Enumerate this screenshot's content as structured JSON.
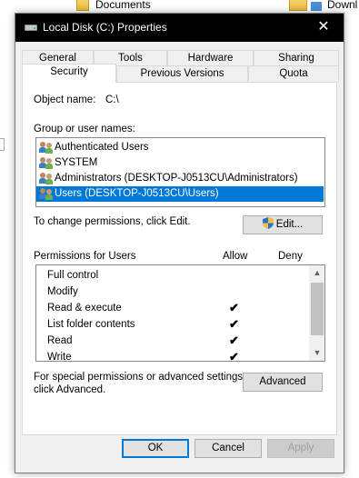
{
  "background": {
    "documents_label": "Documents",
    "downloads_label": "Downl"
  },
  "dialog": {
    "title": "Local Disk (C:) Properties",
    "close_glyph": "✕"
  },
  "tabs": {
    "row1": [
      "General",
      "Tools",
      "Hardware",
      "Sharing"
    ],
    "row2": [
      "Security",
      "Previous Versions",
      "Quota"
    ],
    "active": "Security"
  },
  "security": {
    "object_name_label": "Object name:",
    "object_name_value": "C:\\",
    "group_label": "Group or user names:",
    "groups": [
      "Authenticated Users",
      "SYSTEM",
      "Administrators (DESKTOP-J0513CU\\Administrators)",
      "Users (DESKTOP-J0513CU\\Users)"
    ],
    "selected_group_index": 3,
    "change_hint": "To change permissions, click Edit.",
    "edit_button": "Edit...",
    "permissions_label": "Permissions for Users",
    "allow_header": "Allow",
    "deny_header": "Deny",
    "permissions": [
      {
        "name": "Full control",
        "allow": false,
        "deny": false
      },
      {
        "name": "Modify",
        "allow": false,
        "deny": false
      },
      {
        "name": "Read & execute",
        "allow": true,
        "deny": false
      },
      {
        "name": "List folder contents",
        "allow": true,
        "deny": false
      },
      {
        "name": "Read",
        "allow": true,
        "deny": false
      },
      {
        "name": "Write",
        "allow": true,
        "deny": false
      }
    ],
    "check_glyph": "✔",
    "special_hint_line1": "For special permissions or advanced settings,",
    "special_hint_line2": "click Advanced.",
    "advanced_button": "Advanced"
  },
  "footer": {
    "ok": "OK",
    "cancel": "Cancel",
    "apply": "Apply"
  },
  "colors": {
    "selection": "#0078d7",
    "titlebar": "#000000"
  }
}
